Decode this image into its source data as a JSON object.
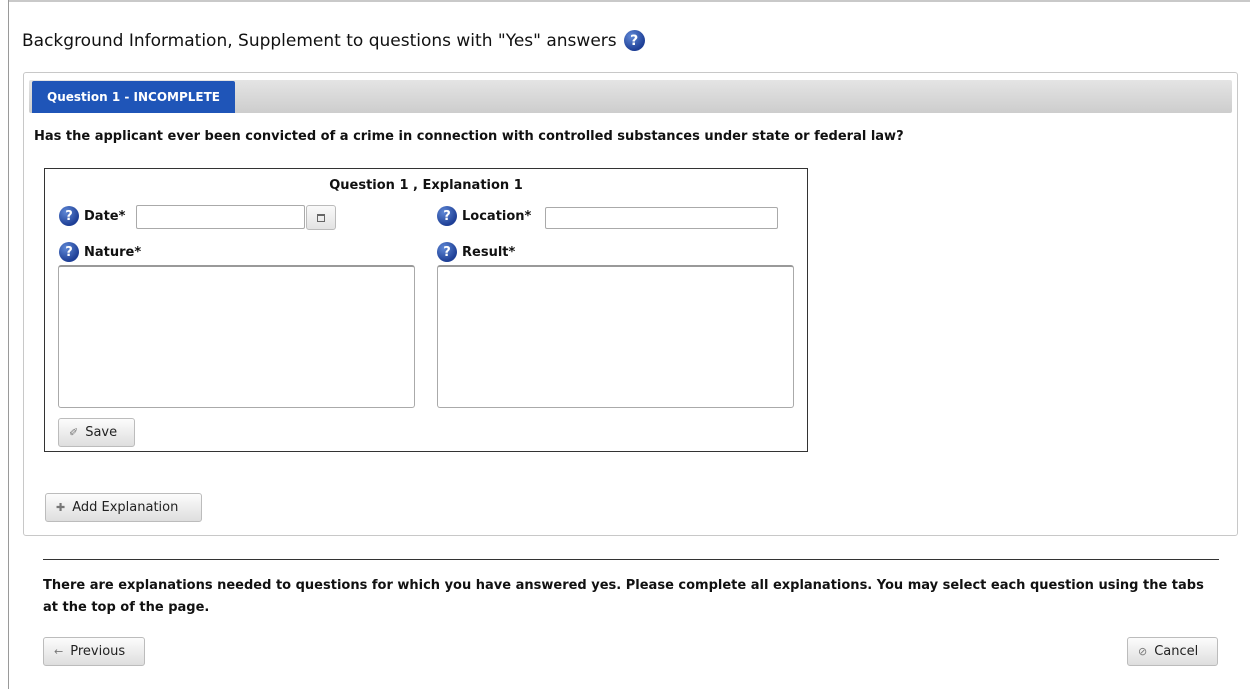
{
  "heading": {
    "title": "Background Information, Supplement to questions with \"Yes\" answers",
    "help_icon": "?"
  },
  "tab": {
    "label": "Question 1 - INCOMPLETE"
  },
  "question": {
    "text": "Has the applicant ever been convicted of a crime in connection with controlled substances under state or federal law?"
  },
  "explanation": {
    "title": "Question 1 , Explanation 1",
    "date_label": "Date*",
    "date_value": "",
    "location_label": "Location*",
    "location_value": "",
    "nature_label": "Nature*",
    "result_label": "Result*",
    "save_label": "Save",
    "help_icon": "?"
  },
  "add_explanation_label": "Add Explanation",
  "footer": {
    "message": "There are explanations needed to questions for which you have answered yes. Please complete all explanations. You may select each question using the tabs at the top of the page.",
    "previous_label": "Previous",
    "cancel_label": "Cancel"
  },
  "icons": {
    "save_icon": "wrench-icon",
    "add_icon": "plus-icon",
    "previous_icon": "arrow-left-icon",
    "cancel_icon": "cancel-circle-icon",
    "calendar_icon": "calendar-icon"
  },
  "colors": {
    "tab_active": "#1f55b8",
    "help_icon": "#1e3f96"
  }
}
